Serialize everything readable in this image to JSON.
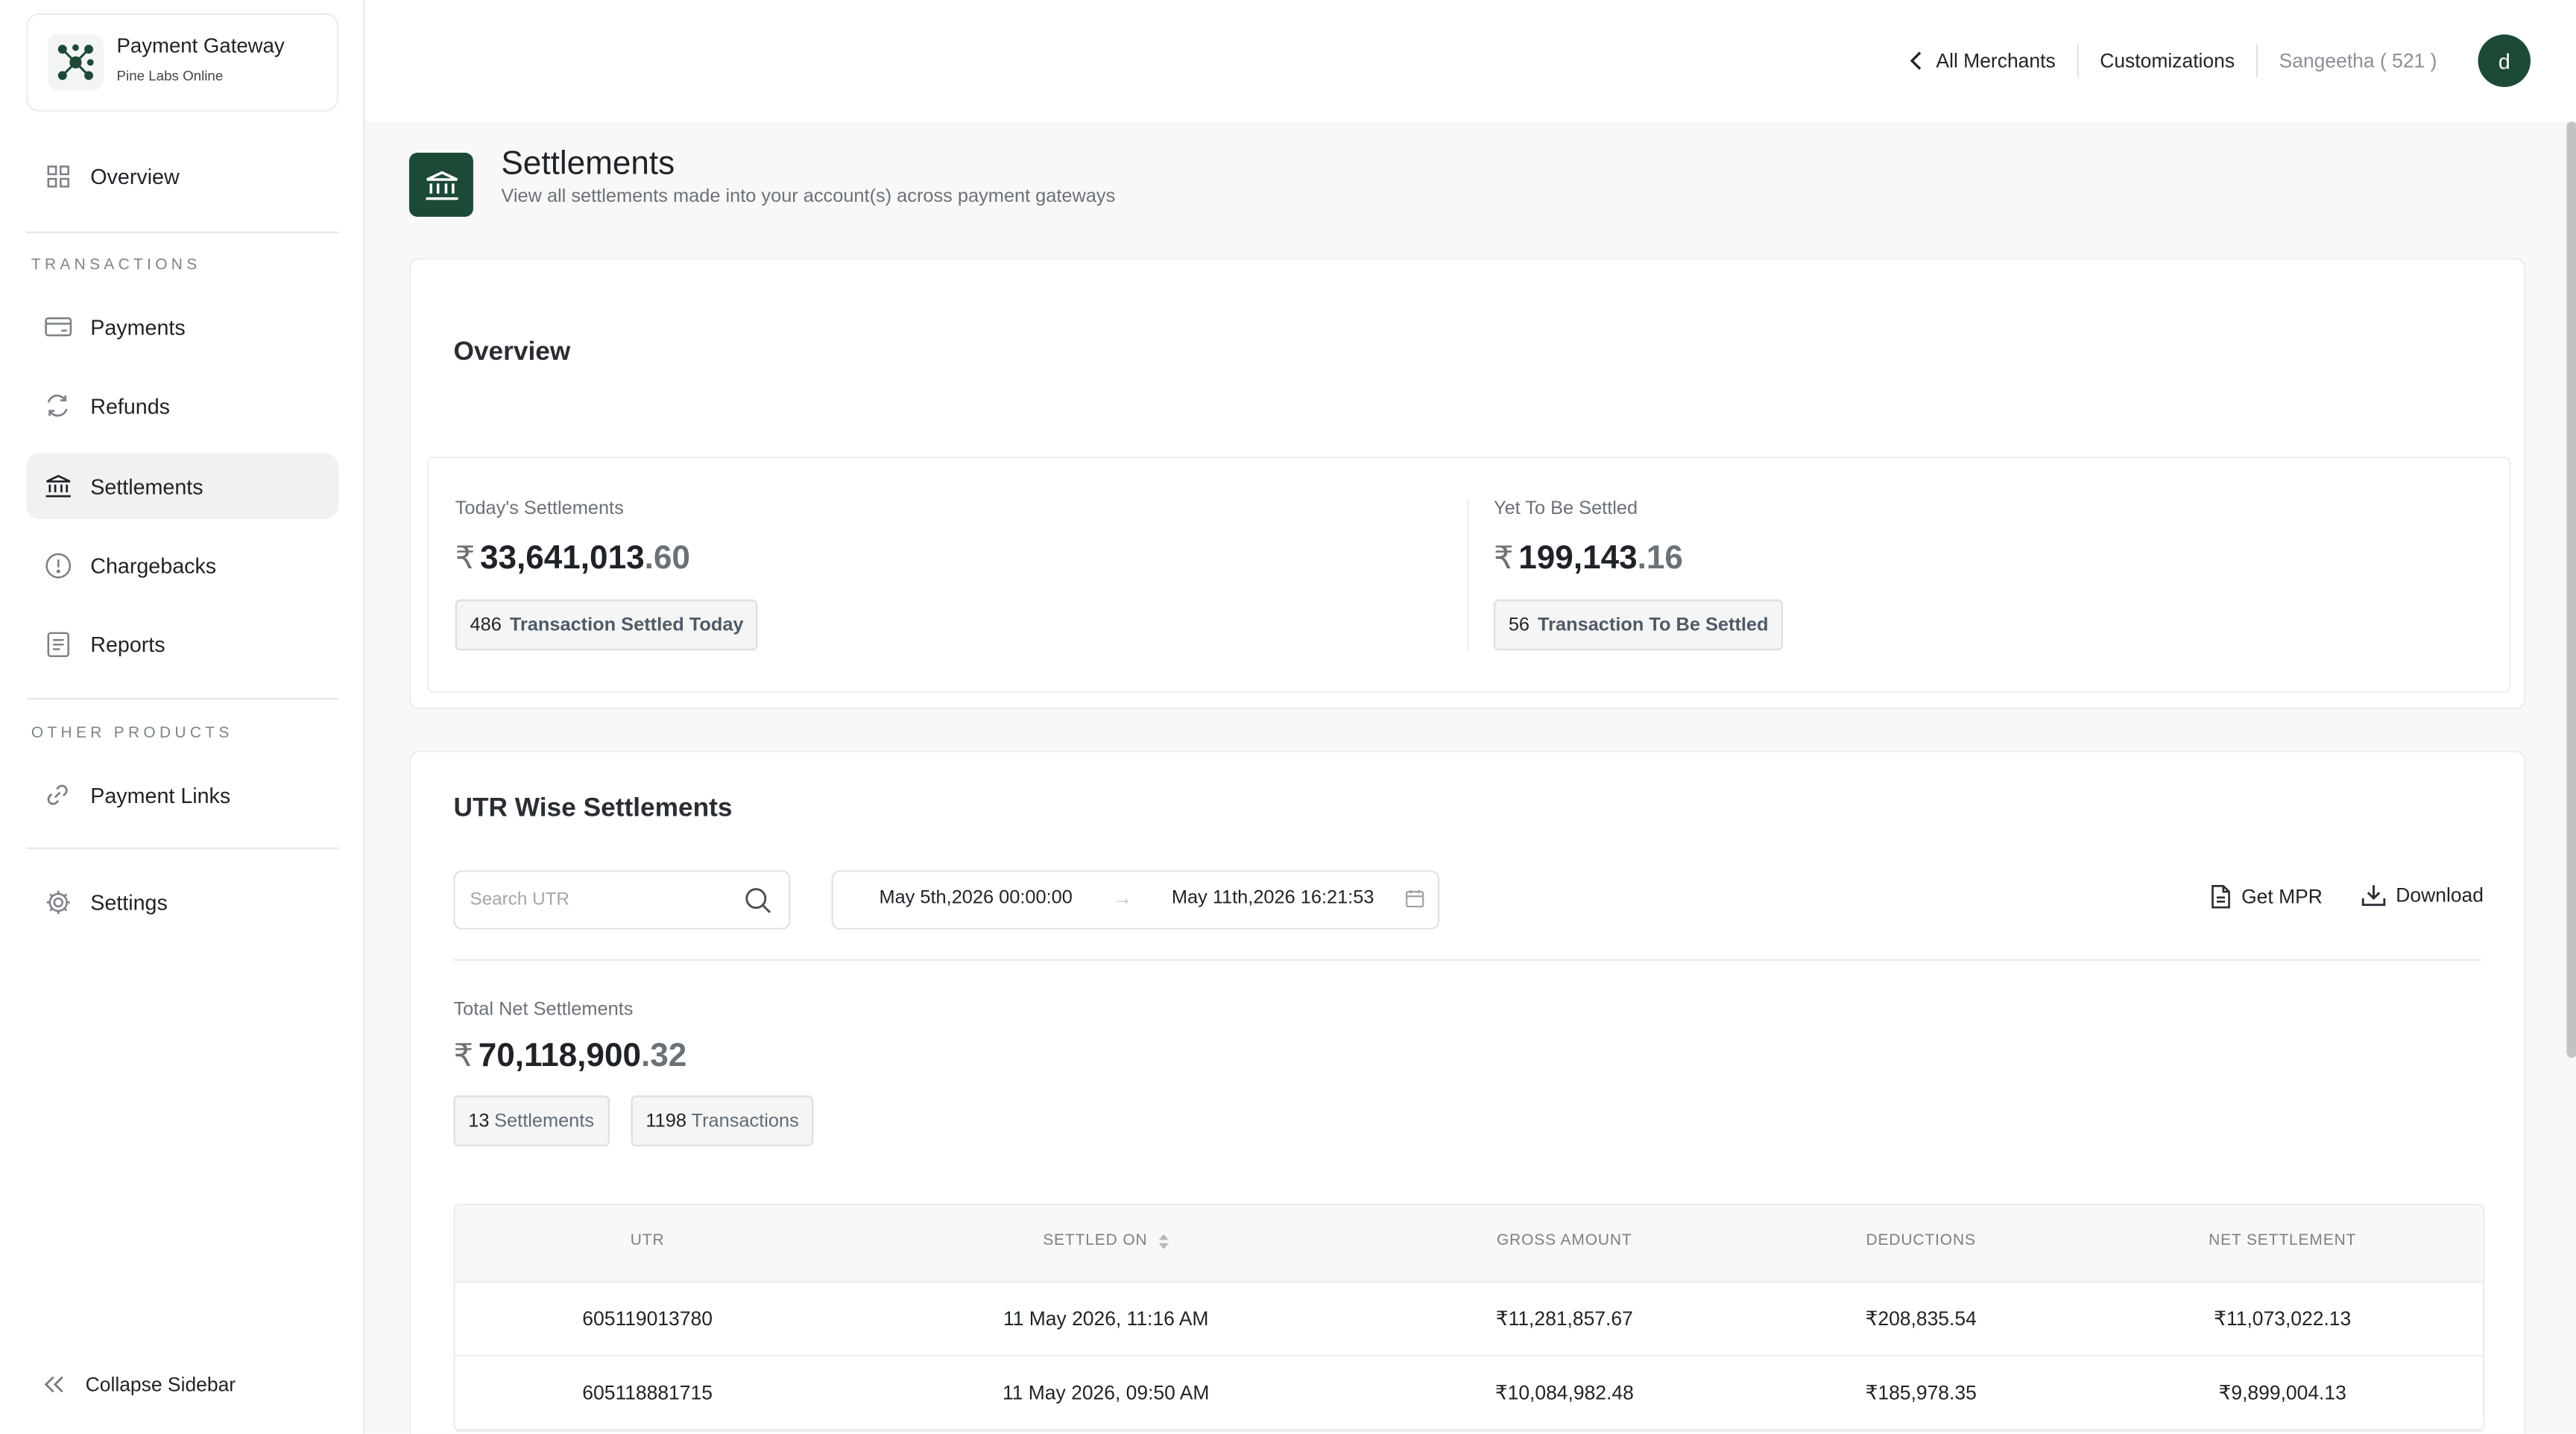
{
  "brand": {
    "title": "Payment Gateway",
    "subtitle": "Pine Labs Online"
  },
  "sidebar": {
    "overview": "Overview",
    "section_transactions": "TRANSACTIONS",
    "payments": "Payments",
    "refunds": "Refunds",
    "settlements": "Settlements",
    "chargebacks": "Chargebacks",
    "reports": "Reports",
    "section_other": "OTHER PRODUCTS",
    "payment_links": "Payment Links",
    "settings": "Settings",
    "collapse": "Collapse Sidebar",
    "active_item": "Settlements"
  },
  "topbar": {
    "all_merchants": "All Merchants",
    "customizations": "Customizations",
    "user": "Sangeetha ( 521 )",
    "avatar_initial": "d"
  },
  "page": {
    "title": "Settlements",
    "subtitle": "View all settlements made into your account(s) across payment gateways"
  },
  "overview": {
    "title": "Overview",
    "today": {
      "label": "Today's Settlements",
      "currency": "₹",
      "amount_int": "33,641,013",
      "amount_dec": ".60",
      "count": "486",
      "count_label": "Transaction Settled Today"
    },
    "pending": {
      "label": "Yet To Be Settled",
      "currency": "₹",
      "amount_int": "199,143",
      "amount_dec": ".16",
      "count": "56",
      "count_label": "Transaction To Be Settled"
    }
  },
  "utr": {
    "title": "UTR Wise Settlements",
    "search_placeholder": "Search UTR",
    "date_from": "May 5th,2026 00:00:00",
    "date_arrow": "→",
    "date_to": "May 11th,2026 16:21:53",
    "get_mpr": "Get MPR",
    "download": "Download",
    "total_label": "Total Net Settlements",
    "total_currency": "₹",
    "total_int": "70,118,900",
    "total_dec": ".32",
    "settlements_count": "13",
    "settlements_label": "Settlements",
    "transactions_count": "1198",
    "transactions_label": "Transactions"
  },
  "table": {
    "headers": {
      "utr": "UTR",
      "settled_on": "SETTLED ON",
      "gross": "GROSS AMOUNT",
      "deductions": "DEDUCTIONS",
      "net": "NET SETTLEMENT"
    },
    "rows": [
      {
        "utr": "605119013780",
        "settled_on": "11 May 2026, 11:16 AM",
        "gross": "₹11,281,857.67",
        "deductions": "₹208,835.54",
        "net": "₹11,073,022.13"
      },
      {
        "utr": "605118881715",
        "settled_on": "11 May 2026, 09:50 AM",
        "gross": "₹10,084,982.48",
        "deductions": "₹185,978.35",
        "net": "₹9,899,004.13"
      }
    ]
  },
  "colors": {
    "brand_green": "#1d4a37",
    "active_bg": "#f1f1f1"
  }
}
